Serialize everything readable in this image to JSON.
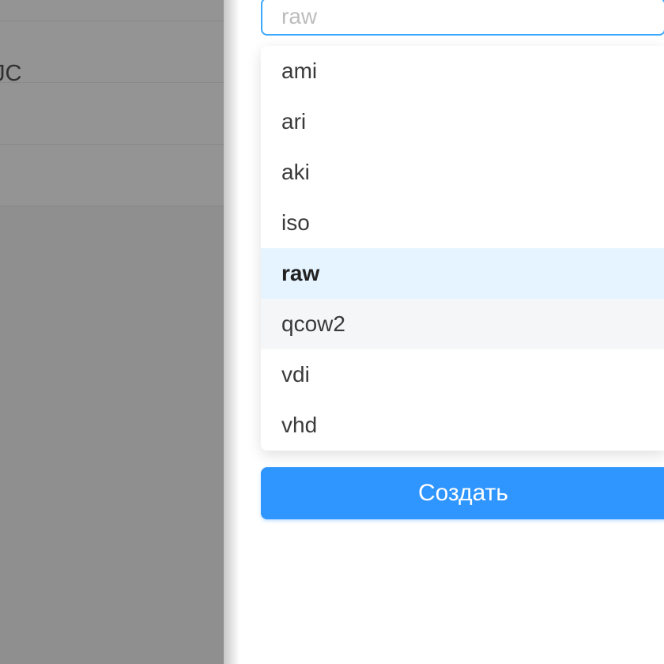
{
  "background": {
    "truncated_text": "JС"
  },
  "select": {
    "placeholder": "raw",
    "options": [
      {
        "label": "ami",
        "state": "normal"
      },
      {
        "label": "ari",
        "state": "normal"
      },
      {
        "label": "aki",
        "state": "normal"
      },
      {
        "label": "iso",
        "state": "normal"
      },
      {
        "label": "raw",
        "state": "selected"
      },
      {
        "label": "qcow2",
        "state": "hovered"
      },
      {
        "label": "vdi",
        "state": "normal"
      },
      {
        "label": "vhd",
        "state": "normal"
      }
    ]
  },
  "buttons": {
    "create": "Создать"
  }
}
